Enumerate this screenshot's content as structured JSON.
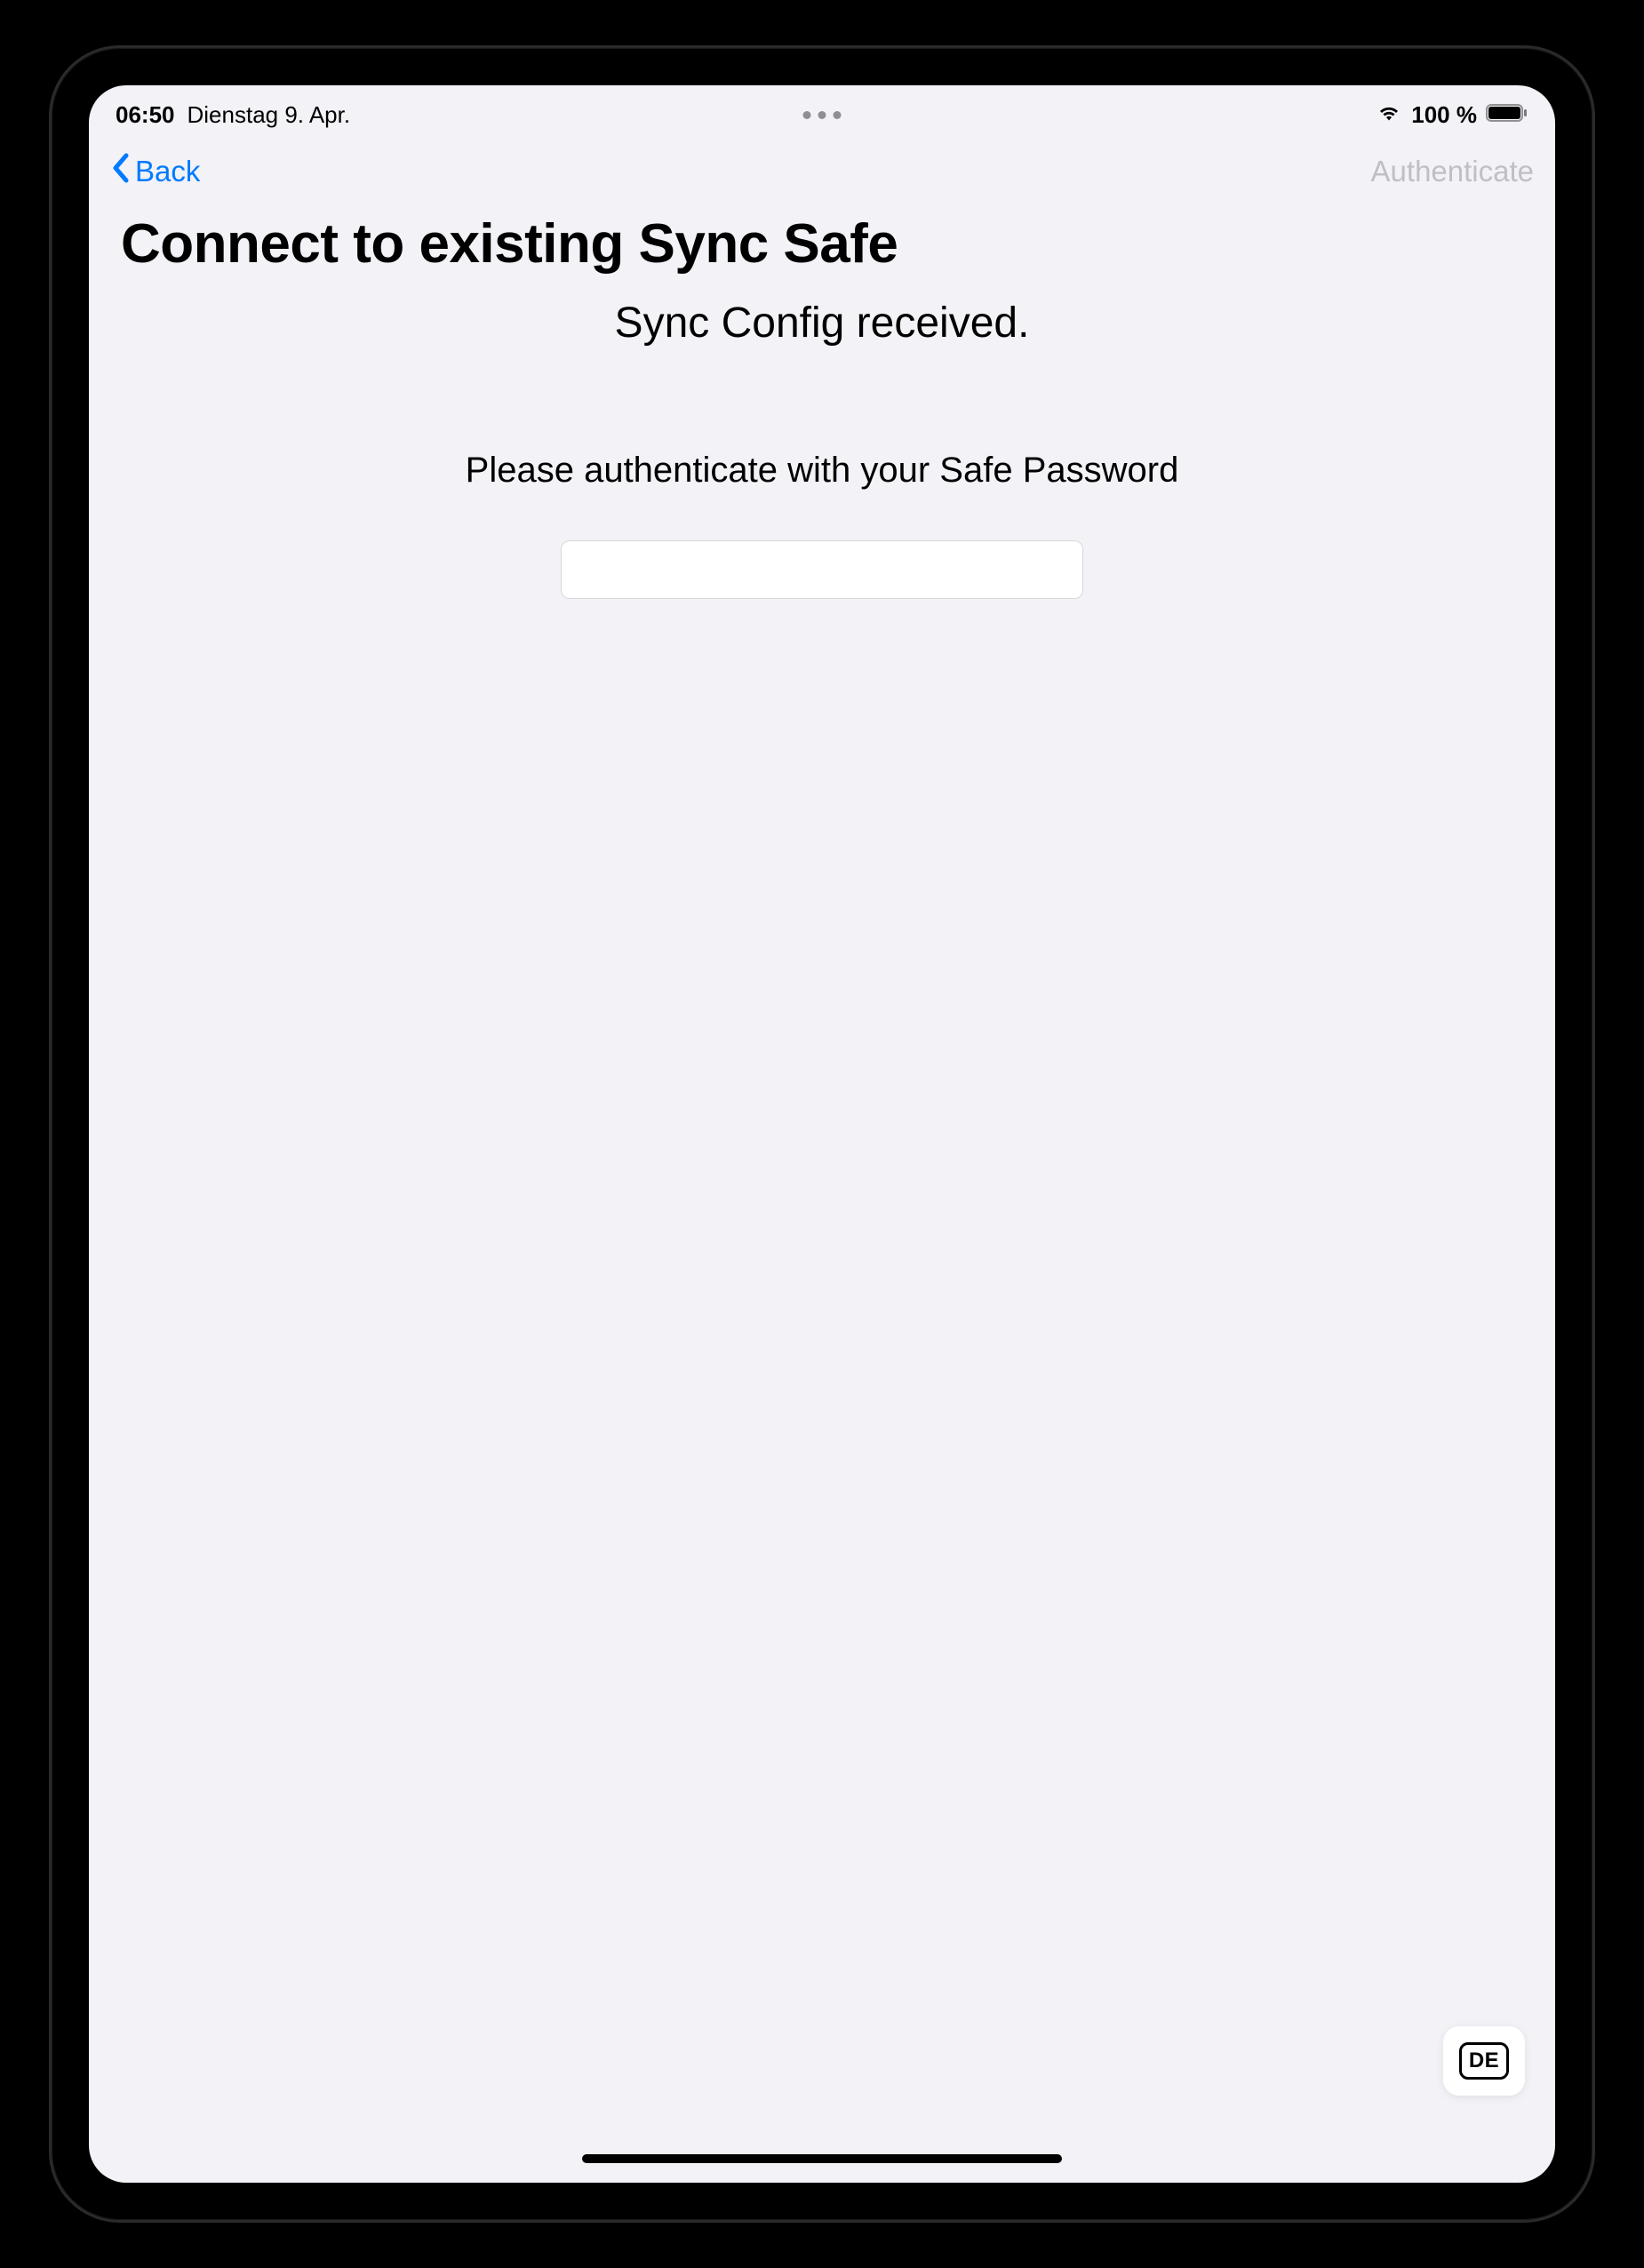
{
  "status": {
    "time": "06:50",
    "date": "Dienstag 9. Apr.",
    "battery": "100 %"
  },
  "nav": {
    "back_label": "Back",
    "authenticate_label": "Authenticate"
  },
  "page": {
    "title": "Connect to existing Sync Safe",
    "subtitle": "Sync Config received.",
    "auth_prompt": "Please authenticate with your Safe Password"
  },
  "input": {
    "password_value": ""
  },
  "keyboard": {
    "lang": "DE"
  }
}
